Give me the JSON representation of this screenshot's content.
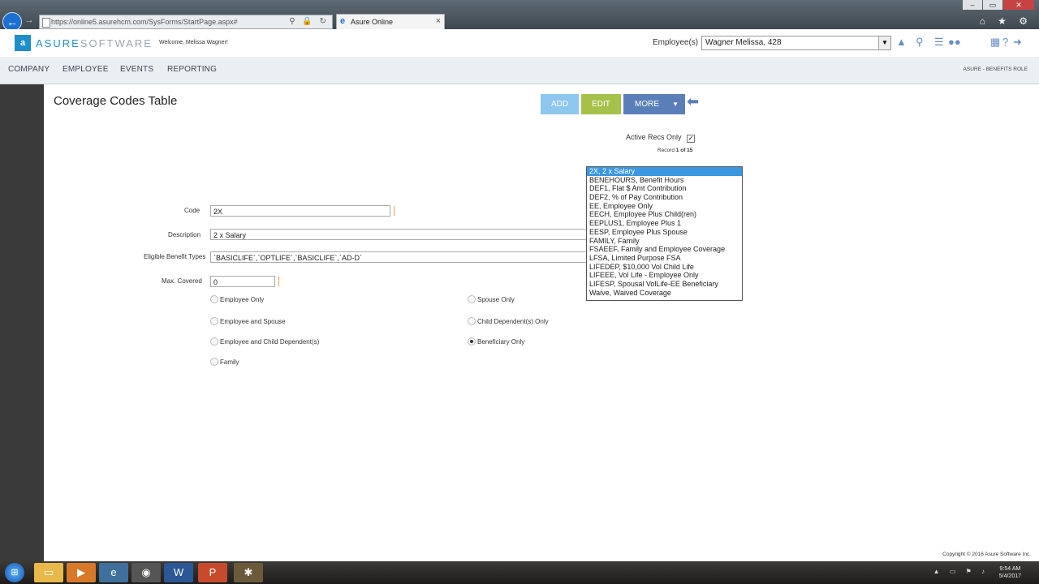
{
  "browser": {
    "url": "https://online5.asurehcm.com/SysForms/StartPage.aspx#",
    "tab_title": "Asure Online",
    "back_glyph": "←",
    "forward_glyph": "→",
    "address_icons": "⚲ 🔒 ↻",
    "tab_close": "×",
    "window_controls": [
      "–",
      "▭",
      "✕"
    ],
    "toolbar_icons": "⌂ ★ ⚙"
  },
  "header": {
    "logo_mark": "a",
    "logo_brand": "ASURE",
    "logo_suffix": "SOFTWARE",
    "welcome": "Welcome, Melissa Wagner!",
    "employee_label": "Employee(s)",
    "employee_value": "Wagner Melissa, 428",
    "icons": [
      "up-arrow-icon",
      "search-icon",
      "list-icon",
      "people-icon",
      "calendar-icon",
      "help-icon",
      "logout-icon"
    ]
  },
  "nav": {
    "items": [
      "COMPANY",
      "EMPLOYEE",
      "EVENTS",
      "REPORTING"
    ],
    "role": "ASURE - BENEFITS ROLE"
  },
  "page": {
    "title": "Coverage Codes Table",
    "buttons": {
      "add": "ADD",
      "edit": "EDIT",
      "more": "MORE"
    },
    "active_recs_label": "Active Recs Only",
    "active_recs_checked": true,
    "record_prefix": "Record",
    "record_current": "1",
    "record_of": "of",
    "record_total": "15"
  },
  "form": {
    "code_label": "Code",
    "code_value": "2X",
    "description_label": "Description",
    "description_value": "2 x Salary",
    "eligible_label": "Eligible Benefit Types",
    "eligible_value": "`BASICLIFE`,`OPTLIFE`,`BASICLIFE`,`AD-D`",
    "max_covered_label": "Max. Covered",
    "max_covered_value": "0",
    "coverage_options": [
      {
        "label": "Employee Only",
        "selected": false
      },
      {
        "label": "Spouse Only",
        "selected": false
      },
      {
        "label": "Employee and Spouse",
        "selected": false
      },
      {
        "label": "Child Dependent(s) Only",
        "selected": false
      },
      {
        "label": "Employee and Child Dependent(s)",
        "selected": false
      },
      {
        "label": "Beneficiary Only",
        "selected": true
      },
      {
        "label": "Family",
        "selected": false
      }
    ]
  },
  "code_list": {
    "selected_index": 0,
    "items": [
      "2X, 2 x Salary",
      "BENEHOURS, Benefit Hours",
      "DEF1, Flat $ Amt Contribution",
      "DEF2, % of Pay Contribution",
      "EE, Employee Only",
      "EECH, Employee Plus Child(ren)",
      "EEPLUS1, Employee Plus 1",
      "EESP, Employee Plus Spouse",
      "FAMILY, Family",
      "FSAEEF, Family and Employee Coverage",
      "LFSA, Limited Purpose FSA",
      "LIFEDEP, $10,000 Vol Child Life",
      "LIFEEE, Vol Life - Employee Only",
      "LIFESP, Spousal VolLife-EE Beneficiary",
      "Waive, Waived Coverage"
    ]
  },
  "footer": {
    "copyright": "Copyright © 2016 Asure Software Inc."
  },
  "taskbar": {
    "time": "9:54 AM",
    "date": "5/4/2017",
    "apps": [
      "start-icon",
      "file-explorer-icon",
      "media-player-icon",
      "internet-explorer-icon",
      "chrome-icon",
      "word-icon",
      "powerpoint-icon",
      "app-icon"
    ]
  }
}
